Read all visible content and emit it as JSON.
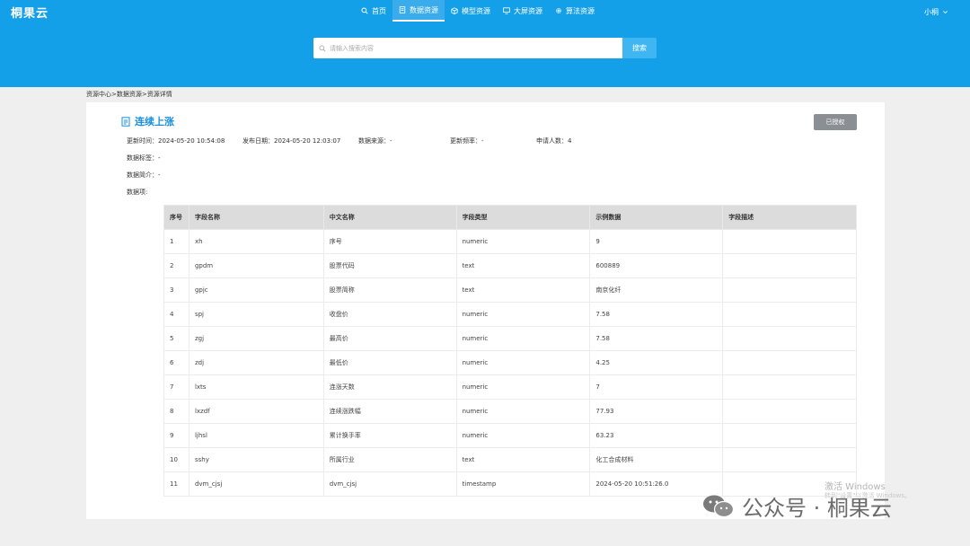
{
  "app": {
    "logo": "桐果云"
  },
  "nav": [
    {
      "label": "首页",
      "icon": "search-icon",
      "active": false
    },
    {
      "label": "数据资源",
      "icon": "document-icon",
      "active": true
    },
    {
      "label": "模型资源",
      "icon": "cube-icon",
      "active": false
    },
    {
      "label": "大屏资源",
      "icon": "monitor-icon",
      "active": false
    },
    {
      "label": "算法资源",
      "icon": "gear-icon",
      "active": false
    }
  ],
  "user": {
    "name": "小桐"
  },
  "search": {
    "placeholder": "请输入搜索内容",
    "button": "搜索"
  },
  "breadcrumb": "资源中心>数据资源>资源详情",
  "detail": {
    "title": "连续上涨",
    "auth_button": "已授权",
    "update_time": "更新时间：2024-05-20 10:54:08",
    "publish_date": "发布日期：2024-05-20 12:03:07",
    "source": "数据来源：-",
    "frequency": "更新频率：-",
    "applicants": "申请人数：4",
    "tags": "数据标签：-",
    "intro": "数据简介：-",
    "fields_label": "数据项:"
  },
  "table": {
    "headers": [
      "序号",
      "字段名称",
      "中文名称",
      "字段类型",
      "示例数据",
      "字段描述"
    ],
    "rows": [
      [
        "1",
        "xh",
        "序号",
        "numeric",
        "9",
        ""
      ],
      [
        "2",
        "gpdm",
        "股票代码",
        "text",
        "600889",
        ""
      ],
      [
        "3",
        "gpjc",
        "股票简称",
        "text",
        "南京化纤",
        ""
      ],
      [
        "4",
        "spj",
        "收盘价",
        "numeric",
        "7.58",
        ""
      ],
      [
        "5",
        "zgj",
        "最高价",
        "numeric",
        "7.58",
        ""
      ],
      [
        "6",
        "zdj",
        "最低价",
        "numeric",
        "4.25",
        ""
      ],
      [
        "7",
        "lxts",
        "连涨天数",
        "numeric",
        "7",
        ""
      ],
      [
        "8",
        "lxzdf",
        "连续涨跌幅",
        "numeric",
        "77.93",
        ""
      ],
      [
        "9",
        "ljhsl",
        "累计换手率",
        "numeric",
        "63.23",
        ""
      ],
      [
        "10",
        "sshy",
        "所属行业",
        "text",
        "化工合成材料",
        ""
      ],
      [
        "11",
        "dvm_cjsj",
        "dvm_cjsj",
        "timestamp",
        "2024-05-20 10:51:26.0",
        ""
      ]
    ]
  },
  "watermarks": {
    "windows_line1": "激活 Windows",
    "windows_line2": "转到\"设置\"以激活 Windows。",
    "wechat": "公众号 · 桐果云"
  }
}
